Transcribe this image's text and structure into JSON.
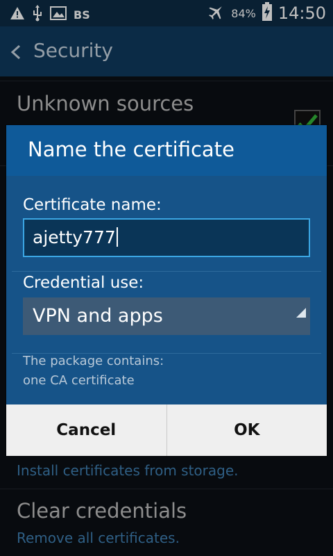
{
  "status_bar": {
    "carrier": "BS",
    "battery_percent": "84%",
    "time": "14:50",
    "icons": [
      "warning-icon",
      "usb-icon",
      "image-icon",
      "airplane-mode-icon",
      "battery-charging-icon"
    ]
  },
  "action_bar": {
    "title": "Security",
    "back_icon": "chevron-left-icon"
  },
  "settings": {
    "unknown_sources_title": "Unknown sources",
    "unknown_sources_checked": true,
    "install_certs_subtitle": "Install certificates from storage.",
    "clear_credentials_title": "Clear credentials",
    "clear_credentials_subtitle": "Remove all certificates."
  },
  "dialog": {
    "title": "Name the certificate",
    "certificate_name_label": "Certificate name:",
    "certificate_name_value": "ajetty777",
    "credential_use_label": "Credential use:",
    "credential_use_value": "VPN and apps",
    "info_line1": "The package contains:",
    "info_line2": "one CA certificate",
    "cancel_label": "Cancel",
    "ok_label": "OK"
  },
  "colors": {
    "dialog_header": "#0f5a99",
    "dialog_body": "#165388",
    "input_border": "#3ba6e3",
    "link_blue": "#3f7fb2"
  }
}
